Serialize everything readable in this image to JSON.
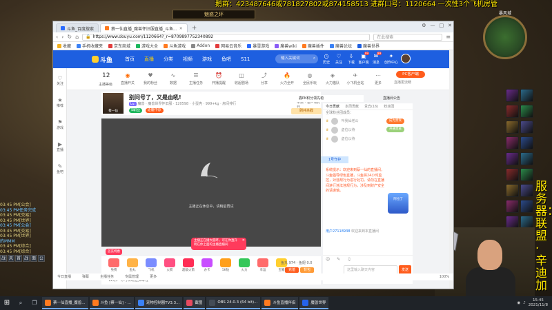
{
  "overlay": {
    "top_text": "鹅群：423487646或781827802或874158513   进群口号：1120664   一次性3个飞机房管",
    "server_text": "服务器：联盟·辛迪加",
    "game_window_title": "魅惑之环",
    "minimap_label": "暴风城"
  },
  "left_chat": [
    "03:45 PM[公会]",
    "03:45 PM任务完成",
    "03:45 PM[交易]",
    "03:45 PM[世界]",
    "03:45 PM[公会]",
    "03:45 PM[交易]",
    "03:45 PM[世界]",
    "  的MMM",
    "03:45 PM[综合]",
    "03:45 PM[综合]"
  ],
  "left_actionbar": [
    "战",
    "风",
    "首",
    "战",
    "面",
    "公"
  ],
  "browser": {
    "tabs": [
      {
        "label": "斗鱼_百度搜索"
      },
      {
        "label": "蔡一仙直播_魔兽怀旧服直播_斗鱼..."
      }
    ],
    "new_tab": "+",
    "window_controls": [
      "⚙",
      "—",
      "□",
      "✕"
    ],
    "url": "https://www.douyu.com/1120664?_r=8709897752340892",
    "search_placeholder": "在此搜索",
    "bookmarks": [
      "收藏",
      "手机收藏夹",
      "京东商城",
      "游戏大全",
      "斗鱼游戏",
      "Addon",
      "网易云音乐",
      "暴雪游戏",
      "魔兽wiki",
      "魔兽插件",
      "魔兽论坛",
      "魔兽世界"
    ]
  },
  "douyu": {
    "logo": "斗鱼",
    "nav": [
      "首页",
      "直播",
      "分类",
      "视频",
      "游戏",
      "鱼吧",
      "S11"
    ],
    "search_placeholder": "输入关键词",
    "header_icons": [
      {
        "label": "历史",
        "badge": ""
      },
      {
        "label": "关注",
        "badge": ""
      },
      {
        "label": "下载",
        "badge": ""
      },
      {
        "label": "客户端",
        "badge": "99"
      },
      {
        "label": "消息",
        "badge": "99"
      },
      {
        "label": "创作中心",
        "badge": ""
      }
    ],
    "rail": [
      "关注",
      "推荐",
      "游戏",
      "直播",
      "鱼吧"
    ],
    "level": {
      "number": "12",
      "label": "主播等级"
    },
    "tools": [
      "直播开关",
      "我的粉丝",
      "数据",
      "主播任务",
      "开播提醒",
      "收起剧场",
      "分享",
      "火力全开",
      "全民乐玩",
      "火力猫队",
      "小飞机全站",
      "更多"
    ],
    "pc_client": "PC客户端",
    "client_note": "直播更流畅",
    "room": {
      "title": "别问号了，又是血吼!",
      "anchor": "蔡一仙",
      "level_badge": "Lv.",
      "meta": "魔兽 · 魔兽世界怀旧服 · 120598 · 小蛋壳 · 999+kg · 房间排行",
      "chips": [
        {
          "text": "S职业",
          "color": "#1eb75d"
        },
        {
          "text": "逐鹿中原",
          "color": "#ff5c1c"
        }
      ],
      "fight": "刷并杀戳",
      "report": "举报 · 客户端打开"
    },
    "video_message": "主播正在休息中，请稍后再试",
    "popup": {
      "line1": "主播正在播大圆环，可在你直升",
      "line2": "跨在你上面的主播直播间"
    },
    "gift_ad": "首充特惠",
    "gifts": [
      {
        "label": "免费",
        "color": "#ff6b6b"
      },
      {
        "label": "鱼丸",
        "color": "#ffb347"
      },
      {
        "label": "飞机",
        "color": "#7a8cff"
      },
      {
        "label": "火箭",
        "color": "#ff4f81"
      },
      {
        "label": "超级火箭",
        "color": "#ff2d55"
      },
      {
        "label": "办卡",
        "color": "#c84dff"
      },
      {
        "label": "5K钻",
        "color": "#ff9f1a"
      },
      {
        "label": "火力",
        "color": "#34c759"
      },
      {
        "label": "幸运",
        "color": "#ff6b6b"
      },
      {
        "label": "宝箱",
        "color": "#ffcf2e"
      }
    ],
    "fish_balls": "鱼丸 974 · 鱼翅 0.0",
    "recharge": "充值",
    "backpack": "背包",
    "bottom_strip": "【1条】 你可以发送弹幕啦~",
    "rank_tip": "鑫PK积分领先稳",
    "live_rank": "直播间公告",
    "chat_tabs": [
      "今日贡献",
      "本周贡献",
      "贵宾(16)",
      "粉丝团"
    ],
    "chat_fans": "全球粉丝团成员：",
    "rank_rows": [
      "叫我仙老公",
      "虚位以待",
      "虚位以待"
    ],
    "rank_btn1": "成为贵宾",
    "rank_btn2": "开通贵族",
    "guard": "1号守护",
    "system_msg": "系统提示：欢迎来到蔡一仙的直播间，斗鱼倡导绿色直播，斗鱼将24小时监控，对违规行为进行处罚。请勿在直播间进行违法违规行为，涉及到财产安全的请谨慎。",
    "tower_ad": "阿拉丁",
    "welcome_user": "用户27118938",
    "welcome_text": " 欢迎来到本直播间",
    "chat_icons": "☺ ✎ ♫",
    "chat_input_placeholder": "这里输入聊天内容",
    "send": "发送",
    "status_left": "今日直播",
    "status_items": [
      "弹幕",
      "主播任务",
      "专属管理",
      "更多"
    ],
    "status_right": "100%"
  },
  "taskbar": {
    "items": [
      {
        "label": "蔡一仙直播_魔兽...",
        "color": "#ff7a1f"
      },
      {
        "label": "斗鱼 [蔡一仙] - ...",
        "color": "#ff7a1f"
      },
      {
        "label": "宠物控制器TV3.3...",
        "color": "#3b82f6"
      },
      {
        "label": "截图",
        "color": "#e84a5f"
      },
      {
        "label": "OBS 24.0.3 (64 bit)...",
        "color": "#444c56"
      },
      {
        "label": "斗鱼直播伴侣",
        "color": "#ff7a1f"
      },
      {
        "label": "魔兽世界",
        "color": "#2563eb"
      }
    ],
    "time": "15:45",
    "date": "2021/11/8"
  }
}
